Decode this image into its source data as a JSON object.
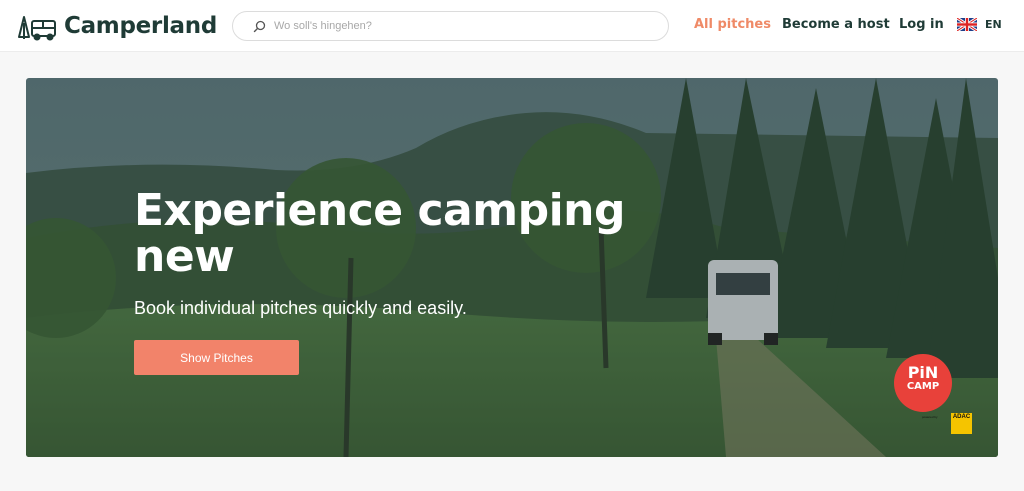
{
  "header": {
    "brand": "Camperland",
    "search": {
      "placeholder": "Wo soll's hingehen?",
      "value": ""
    },
    "nav": [
      {
        "label": "All pitches",
        "active": true
      },
      {
        "label": "Become a host",
        "active": false
      },
      {
        "label": "Log in",
        "active": false
      }
    ],
    "language": {
      "code": "EN",
      "flag": "uk-flag-icon"
    }
  },
  "hero": {
    "title": "Experience camping new",
    "subtitle": "Book individual pitches quickly and easily.",
    "cta_label": "Show Pitches"
  },
  "badges": {
    "pincamp_top": "PiN",
    "pincamp_bottom": "CAMP",
    "adac_prefix": "powered by",
    "adac": "ADAC"
  },
  "colors": {
    "brand_dark": "#1f3b36",
    "accent": "#ef8a67",
    "button": "#f2836a",
    "pincamp_red": "#e8413a",
    "adac_yellow": "#f5c400"
  },
  "icons": [
    "camper-logo-icon",
    "search-icon",
    "uk-flag-icon"
  ]
}
